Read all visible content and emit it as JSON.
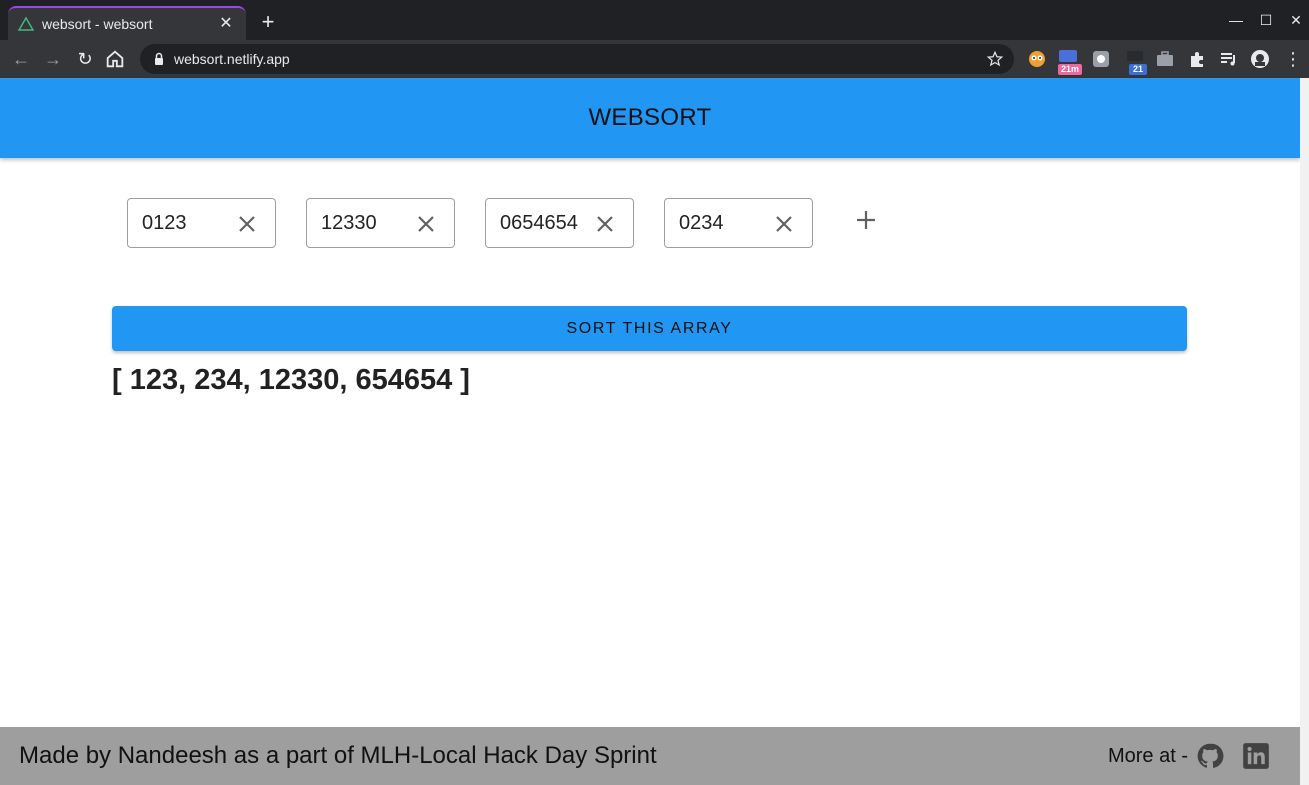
{
  "browser": {
    "tab_title": "websort - websort",
    "url": "websort.netlify.app",
    "extension_badges": [
      "21m",
      "21"
    ]
  },
  "app": {
    "title": "WEBSORT"
  },
  "inputs": [
    {
      "value": "0123"
    },
    {
      "value": "12330"
    },
    {
      "value": "0654654"
    },
    {
      "value": "0234"
    }
  ],
  "sort_button_label": "SORT THIS ARRAY",
  "result": "[ 123, 234, 12330, 654654 ]",
  "footer": {
    "credit": "Made by Nandeesh as a part of MLH-Local Hack Day Sprint",
    "more_at": "More at -"
  },
  "colors": {
    "primary": "#2196f3",
    "footer": "#9e9e9e"
  }
}
